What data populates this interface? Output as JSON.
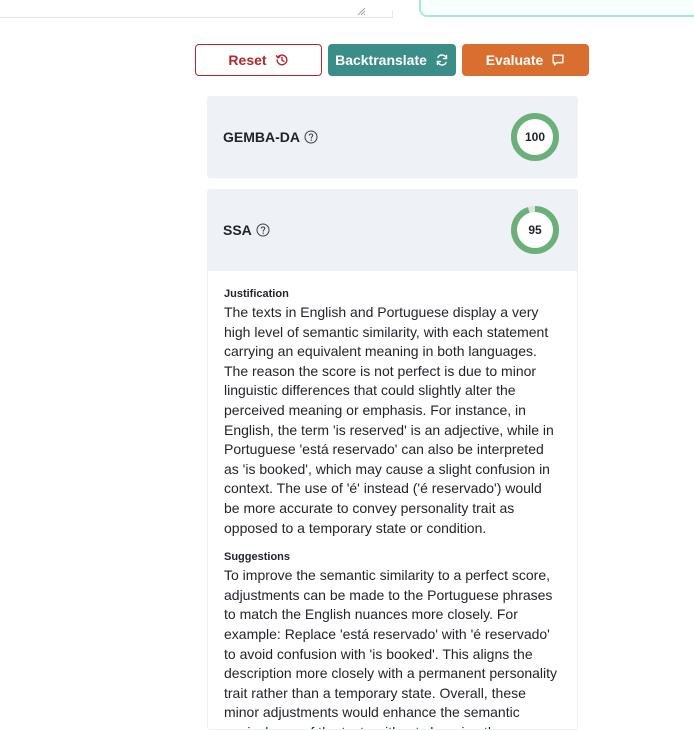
{
  "buttons": {
    "reset_label": "Reset",
    "backtranslate_label": "Backtranslate",
    "evaluate_label": "Evaluate",
    "reset_icon": "history-icon",
    "backtranslate_icon": "refresh-icon",
    "evaluate_icon": "comment-icon"
  },
  "metrics": {
    "gemba": {
      "title": "GEMBA-DA",
      "score": "100",
      "score_fraction": 1.0
    },
    "ssa": {
      "title": "SSA",
      "score": "95",
      "score_fraction": 0.95
    }
  },
  "ssa_details": {
    "justification_title": "Justification",
    "justification_text": "The texts in English and Portuguese display a very high level of semantic similarity, with each statement carrying an equivalent meaning in both languages. The reason the score is not perfect is due to minor linguistic differences that could slightly alter the perceived meaning or emphasis. For instance, in English, the term 'is reserved' is an adjective, while in Portuguese 'está reservado' can also be interpreted as 'is booked', which may cause a slight confusion in context. The use of 'é' instead ('é reservado') would be more accurate to convey personality trait as opposed to a temporary state or condition.",
    "suggestions_title": "Suggestions",
    "suggestions_text": "To improve the semantic similarity to a perfect score, adjustments can be made to the Portuguese phrases to match the English nuances more closely. For example: Replace 'está reservado' with 'é reservado' to avoid confusion with 'is booked'. This aligns the description more closely with a permanent personality trait rather than a temporary state. Overall, these minor adjustments would enhance the semantic equivalence of the texts without changing the core message of each statement."
  },
  "colors": {
    "reset_red": "#b12a2a",
    "backtranslate_teal": "#3b8d88",
    "evaluate_orange": "#d96f2f",
    "score_green": "#6bb07a",
    "score_track": "#d9e7dc",
    "card_header_bg": "#eef1f6"
  }
}
